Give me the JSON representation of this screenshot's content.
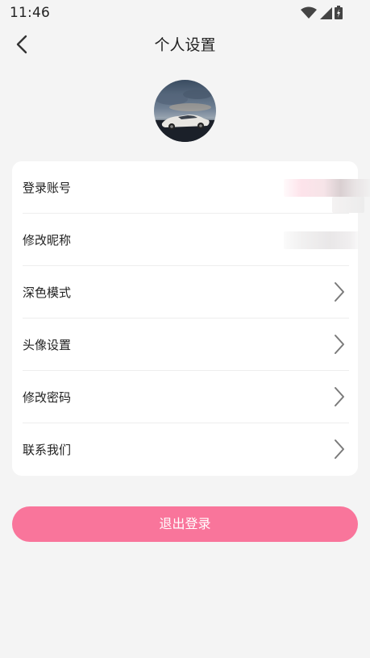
{
  "status_bar": {
    "time": "11:46",
    "icons": [
      "wifi-icon",
      "cellular-signal-icon",
      "battery-charging-icon"
    ]
  },
  "header": {
    "title": "个人设置",
    "back_icon": "chevron-left-icon"
  },
  "avatar": {
    "description_icon": "avatar-car-photo"
  },
  "settings": {
    "items": [
      {
        "label": "登录账号",
        "value_blurred": true
      },
      {
        "label": "修改昵称",
        "value_blurred": true
      },
      {
        "label": "深色模式"
      },
      {
        "label": "头像设置"
      },
      {
        "label": "修改密码"
      },
      {
        "label": "联系我们"
      }
    ]
  },
  "logout": {
    "label": "退出登录"
  },
  "colors": {
    "accent": "#f9759b",
    "background": "#f4f4f4",
    "card": "#ffffff",
    "chevron": "#7a7a7a"
  }
}
